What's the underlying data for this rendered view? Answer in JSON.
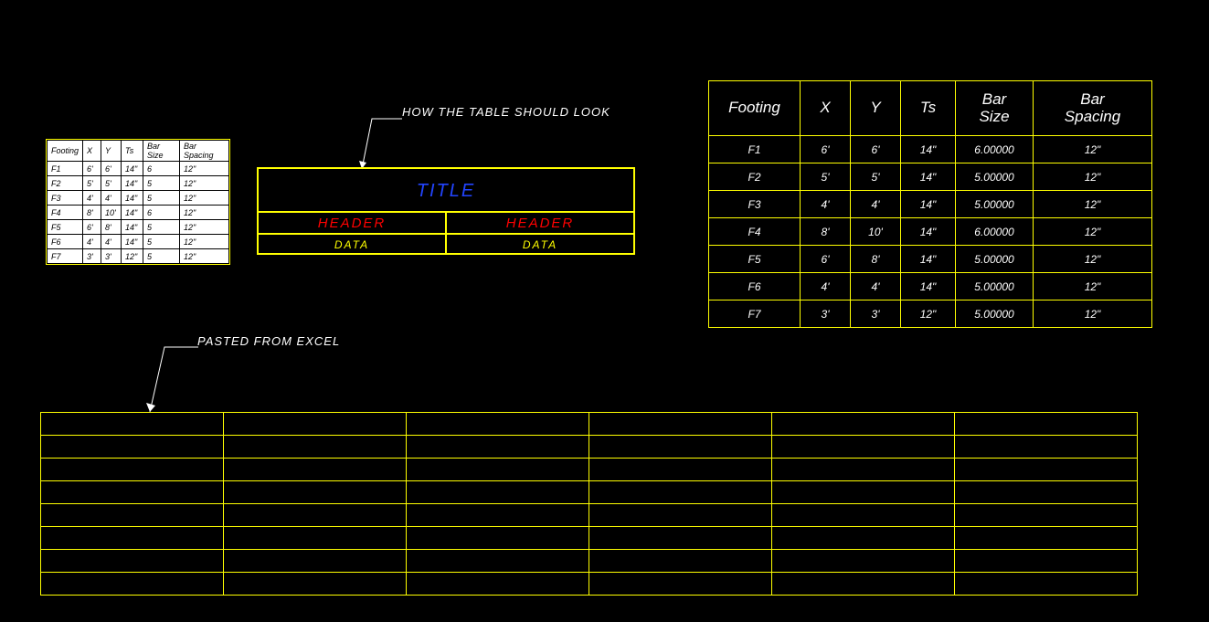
{
  "labels": {
    "legend_note": "HOW THE TABLE SHOULD LOOK",
    "paste_note": "PASTED FROM EXCEL"
  },
  "legend_table": {
    "title": "TITLE",
    "header": "HEADER",
    "data": "DATA"
  },
  "ole_table": {
    "headers": [
      "Footing",
      "X",
      "Y",
      "Ts",
      "Bar Size",
      "Bar Spacing"
    ],
    "rows": [
      [
        "F1",
        "6'",
        "6'",
        "14\"",
        "6",
        "12\""
      ],
      [
        "F2",
        "5'",
        "5'",
        "14\"",
        "5",
        "12\""
      ],
      [
        "F3",
        "4'",
        "4'",
        "14\"",
        "5",
        "12\""
      ],
      [
        "F4",
        "8'",
        "10'",
        "14\"",
        "6",
        "12\""
      ],
      [
        "F5",
        "6'",
        "8'",
        "14\"",
        "5",
        "12\""
      ],
      [
        "F6",
        "4'",
        "4'",
        "14\"",
        "5",
        "12\""
      ],
      [
        "F7",
        "3'",
        "3'",
        "12\"",
        "5",
        "12\""
      ]
    ]
  },
  "cad_table": {
    "headers": [
      "Footing",
      "X",
      "Y",
      "Ts",
      "Bar\nSize",
      "Bar\nSpacing"
    ],
    "rows": [
      [
        "F1",
        "6'",
        "6'",
        "14\"",
        "6.00000",
        "12\""
      ],
      [
        "F2",
        "5'",
        "5'",
        "14\"",
        "5.00000",
        "12\""
      ],
      [
        "F3",
        "4'",
        "4'",
        "14\"",
        "5.00000",
        "12\""
      ],
      [
        "F4",
        "8'",
        "10'",
        "14\"",
        "6.00000",
        "12\""
      ],
      [
        "F5",
        "6'",
        "8'",
        "14\"",
        "5.00000",
        "12\""
      ],
      [
        "F6",
        "4'",
        "4'",
        "14\"",
        "5.00000",
        "12\""
      ],
      [
        "F7",
        "3'",
        "3'",
        "12\"",
        "5.00000",
        "12\""
      ]
    ]
  },
  "big_grid": {
    "rows": 8,
    "cols": 6
  }
}
